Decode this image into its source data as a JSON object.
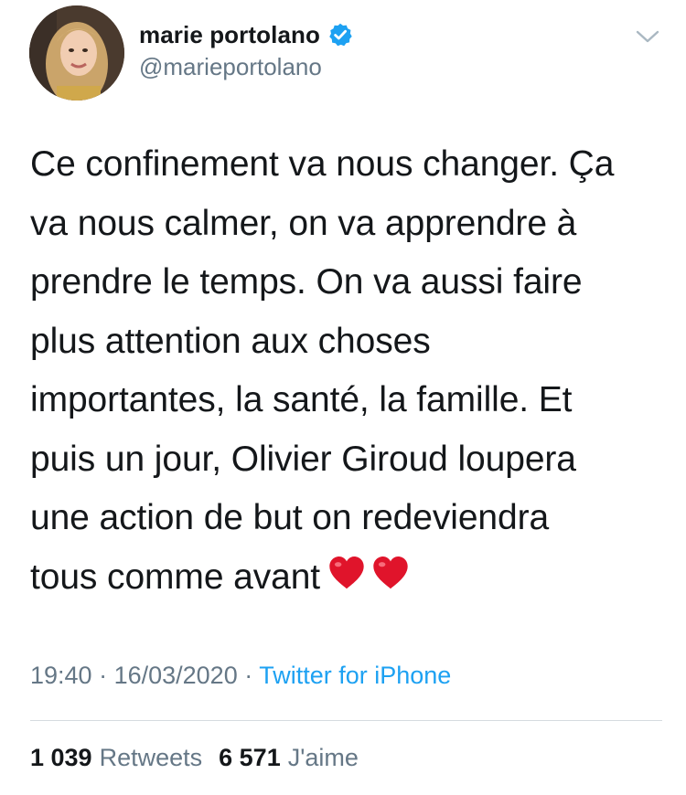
{
  "user": {
    "display_name": "marie portolano",
    "handle": "@marieportolano",
    "verified": true,
    "avatar_icon": "profile-photo",
    "verified_icon": "verified-badge-icon",
    "menu_icon": "chevron-down-icon"
  },
  "tweet": {
    "text_lines": [
      "Ce confinement va nous changer. Ça",
      "va nous calmer, on va apprendre à",
      "prendre le temps. On va aussi faire",
      "plus attention aux choses",
      "importantes, la santé, la famille. Et",
      "puis un jour, Olivier Giroud loupera",
      "une action de but on redeviendra",
      "tous comme avant"
    ],
    "emoji": [
      "red-heart-emoji",
      "red-heart-emoji"
    ]
  },
  "meta": {
    "time": "19:40",
    "separator": " · ",
    "date": "16/03/2020",
    "separator2": " · ",
    "source": "Twitter for iPhone"
  },
  "stats": {
    "retweets_count": "1 039",
    "retweets_label": "Retweets",
    "likes_count": "6 571",
    "likes_label": "J'aime"
  },
  "colors": {
    "text": "#14171a",
    "secondary": "#657786",
    "link": "#1da1f2",
    "verified": "#1da1f2",
    "divider": "#d6dbdf",
    "heart": "#e0142b"
  }
}
